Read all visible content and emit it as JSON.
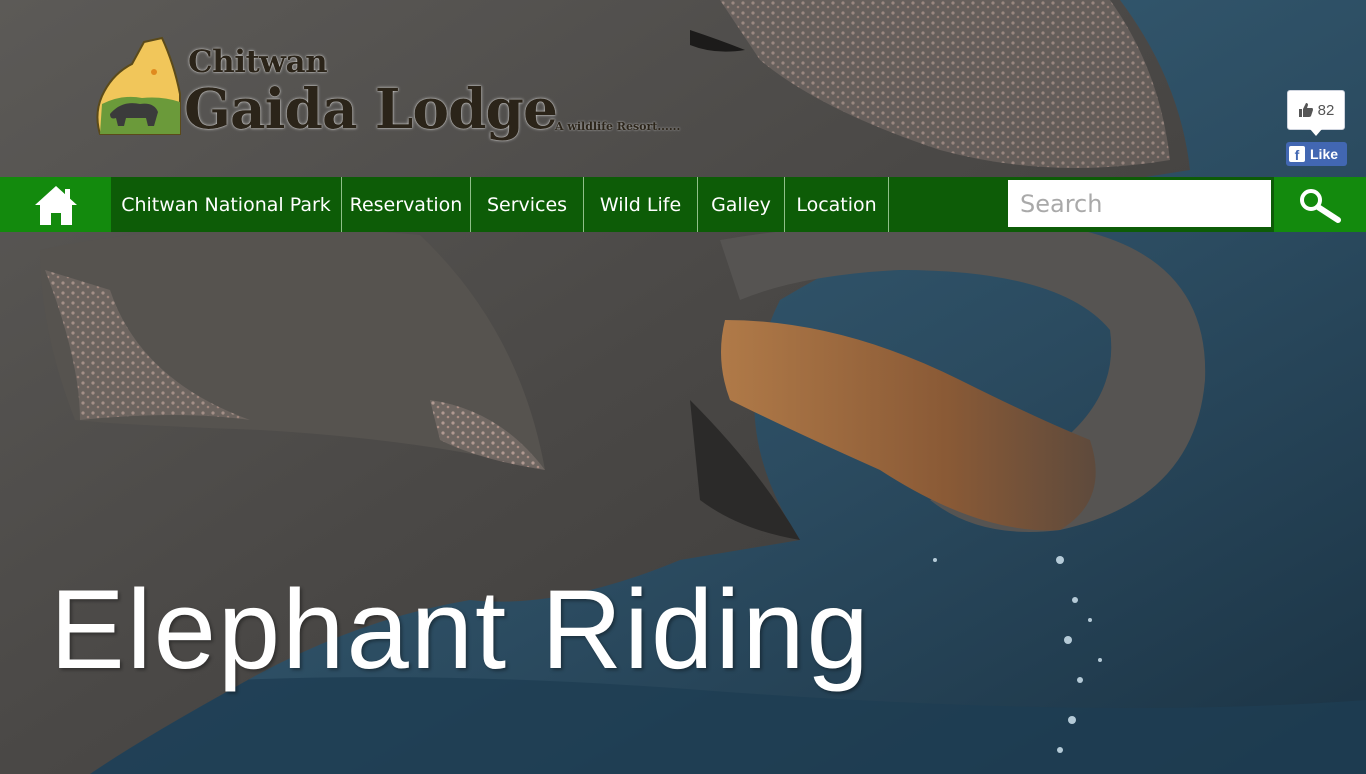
{
  "brand": {
    "name_line1": "Chitwan",
    "name_line2": "Gaida Lodge",
    "tagline": "A wildlife Resort......"
  },
  "facebook": {
    "like_count": "82",
    "like_label": "Like",
    "f_glyph": "f"
  },
  "nav": {
    "home_icon": "home-icon",
    "items": [
      {
        "label": "Chitwan National Park"
      },
      {
        "label": "Reservation"
      },
      {
        "label": "Services"
      },
      {
        "label": "Wild Life"
      },
      {
        "label": "Galley"
      },
      {
        "label": "Location"
      }
    ]
  },
  "search": {
    "placeholder": "Search",
    "value": "",
    "icon": "magnifier-icon"
  },
  "hero": {
    "title": "Elephant Riding",
    "image": "elephant-drinking-water"
  },
  "colors": {
    "nav_bg": "#0d5c07",
    "nav_accent": "#138a0d",
    "facebook_blue": "#4267b2",
    "water": "#2c4d63"
  }
}
